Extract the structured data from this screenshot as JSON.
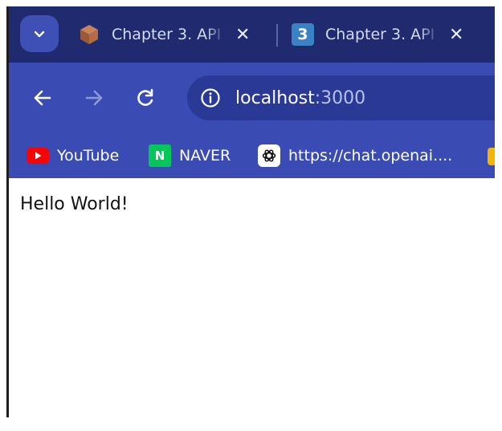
{
  "tabs": [
    {
      "label": "Chapter 3. API",
      "icon": "package-box-icon"
    },
    {
      "label": "Chapter 3. API",
      "icon": "number-3-icon",
      "icon_text": "3"
    }
  ],
  "toolbar": {
    "url_host": "localhost",
    "url_port": ":3000"
  },
  "bookmarks": [
    {
      "label": "YouTube",
      "icon": "youtube-icon",
      "color": "#ff0000"
    },
    {
      "label": "NAVER",
      "icon": "naver-icon",
      "icon_text": "N",
      "color": "#03c75a"
    },
    {
      "label": "https://chat.openai....",
      "icon": "openai-icon",
      "color": "#ffffff"
    }
  ],
  "page": {
    "text": "Hello World!"
  },
  "colors": {
    "tabstrip": "#1f2b6e",
    "toolbar": "#3a4cb4",
    "omnibox": "#2a3896"
  }
}
